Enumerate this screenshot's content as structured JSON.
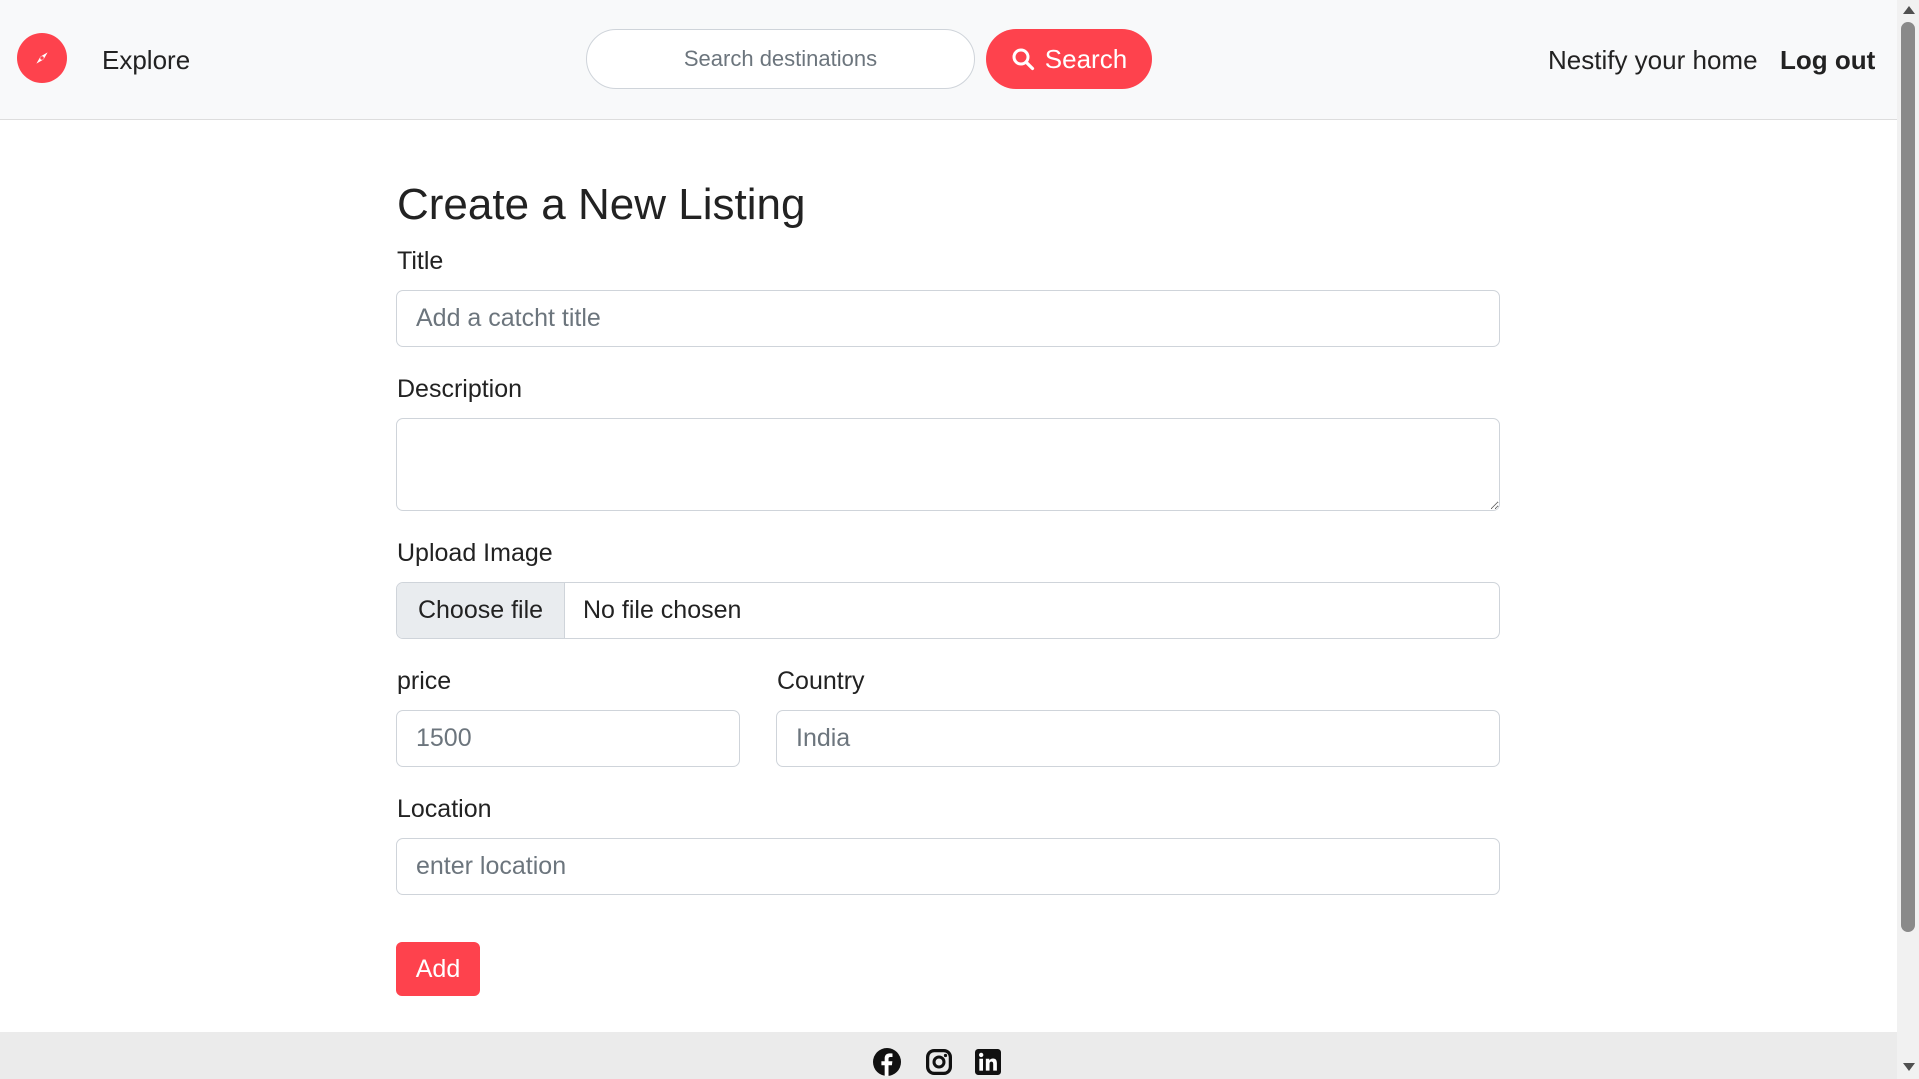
{
  "navbar": {
    "brand_icon": "compass-icon",
    "explore_label": "Explore",
    "search_placeholder": "Search destinations",
    "search_button_label": "Search",
    "nestify_label": "Nestify your home",
    "logout_label": "Log out"
  },
  "form": {
    "heading": "Create a New Listing",
    "title_label": "Title",
    "title_placeholder": "Add a catcht title",
    "description_label": "Description",
    "description_value": "",
    "image_label": "Upload Image",
    "file_button_label": "Choose file",
    "file_status": "No file chosen",
    "price_label": "price",
    "price_placeholder": "1500",
    "country_label": "Country",
    "country_placeholder": "India",
    "location_label": "Location",
    "location_placeholder": "enter location",
    "submit_label": "Add"
  },
  "footer": {
    "social_icons": [
      "facebook-icon",
      "instagram-icon",
      "linkedin-icon"
    ]
  },
  "colors": {
    "accent": "#fe424d",
    "navbar_bg": "#f8f9fa",
    "footer_bg": "#ebebeb"
  }
}
